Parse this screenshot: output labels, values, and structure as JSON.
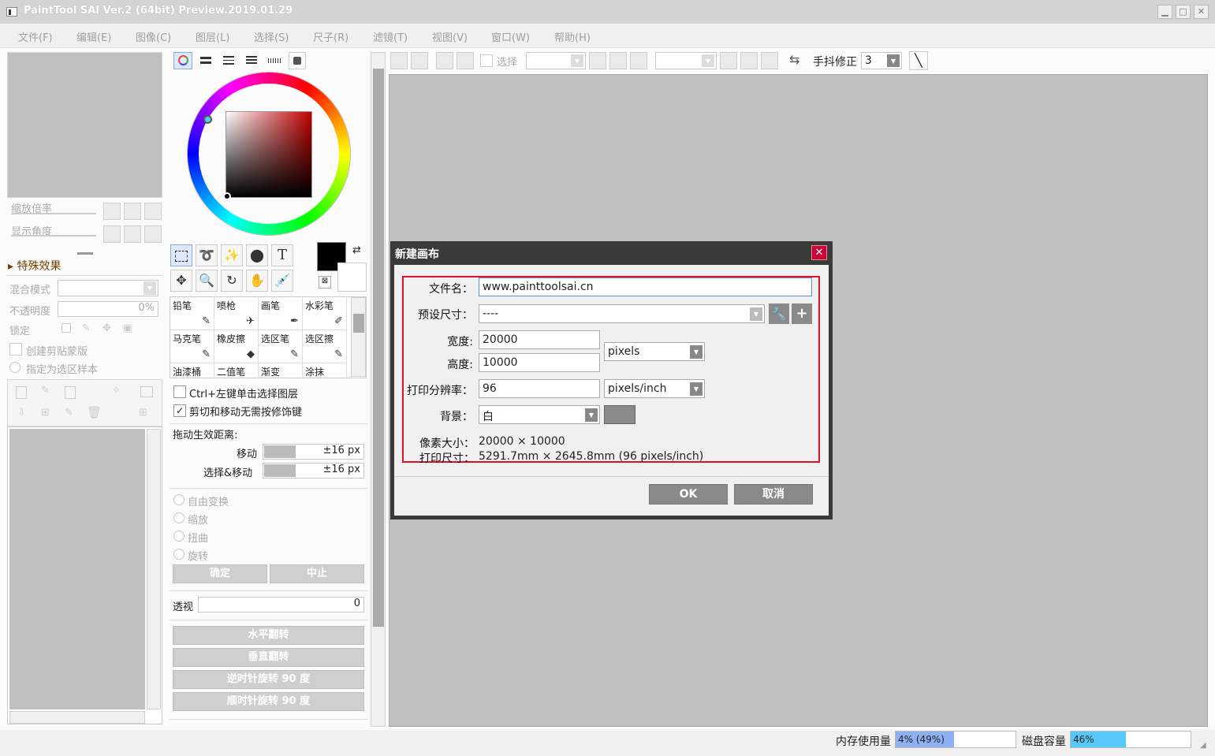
{
  "window": {
    "title": "PaintTool SAI Ver.2 (64bit) Preview.2019.01.29"
  },
  "menu": [
    "文件(F)",
    "编辑(E)",
    "图像(C)",
    "图层(L)",
    "选择(S)",
    "尺子(R)",
    "滤镜(T)",
    "视图(V)",
    "窗口(W)",
    "帮助(H)"
  ],
  "navigator": {
    "zoom_label": "缩放倍率",
    "angle_label": "显示角度"
  },
  "effects": {
    "header": "特殊效果",
    "blend_label": "混合模式",
    "opacity_label": "不透明度",
    "opacity_value": "0%",
    "lock_label": "锁定",
    "clip_label": "创建剪贴蒙版",
    "sel_label": "指定为选区样本"
  },
  "brushes": [
    {
      "name": "铅笔"
    },
    {
      "name": "喷枪"
    },
    {
      "name": "画笔"
    },
    {
      "name": "水彩笔"
    },
    {
      "name": "马克笔"
    },
    {
      "name": "橡皮擦"
    },
    {
      "name": "选区笔"
    },
    {
      "name": "选区擦"
    },
    {
      "name": "油漆桶"
    },
    {
      "name": "二值笔"
    },
    {
      "name": "渐变"
    },
    {
      "name": "涂抹"
    }
  ],
  "tool_options": {
    "ctrl_click": "Ctrl+左键单击选择图层",
    "cut_move": "剪切和移动无需按修饰键",
    "drag_label": "拖动生效距离:",
    "move_label": "移动",
    "move_value": "±16 px",
    "selmove_label": "选择&移动",
    "selmove_value": "±16 px",
    "transforms": [
      "自由变换",
      "缩放",
      "扭曲",
      "旋转"
    ],
    "confirm": "确定",
    "abort": "中止",
    "perspective_label": "透视",
    "perspective_value": "0",
    "flip_h": "水平翻转",
    "flip_v": "垂直翻转",
    "rot_ccw": "逆时针旋转 90 度",
    "rot_cw": "顺时针旋转 90 度"
  },
  "toolbar": {
    "select_label": "选择",
    "stabilizer_label": "手抖修正",
    "stabilizer_value": "3"
  },
  "dialog": {
    "title": "新建画布",
    "filename_label": "文件名：",
    "filename_value": "www.painttoolsai.cn",
    "preset_label": "预设尺寸：",
    "preset_value": "----",
    "width_label": "宽度:",
    "width_value": "20000",
    "height_label": "高度:",
    "height_value": "10000",
    "unit_value": "pixels",
    "dpi_label": "打印分辨率：",
    "dpi_value": "96",
    "dpi_unit": "pixels/inch",
    "bg_label": "背景：",
    "bg_value": "白",
    "pixel_size_label": "像素大小：",
    "pixel_size_value": "20000 × 10000",
    "print_size_label": "打印尺寸：",
    "print_size_value": "5291.7mm × 2645.8mm (96 pixels/inch)",
    "ok": "OK",
    "cancel": "取消",
    "highlight_color": "#e0102a"
  },
  "status": {
    "mem_label": "内存使用量",
    "mem_value": "4% (49%)",
    "mem_fill": 0.49,
    "disk_label": "磁盘容量",
    "disk_value": "46%",
    "disk_fill": 0.46
  }
}
